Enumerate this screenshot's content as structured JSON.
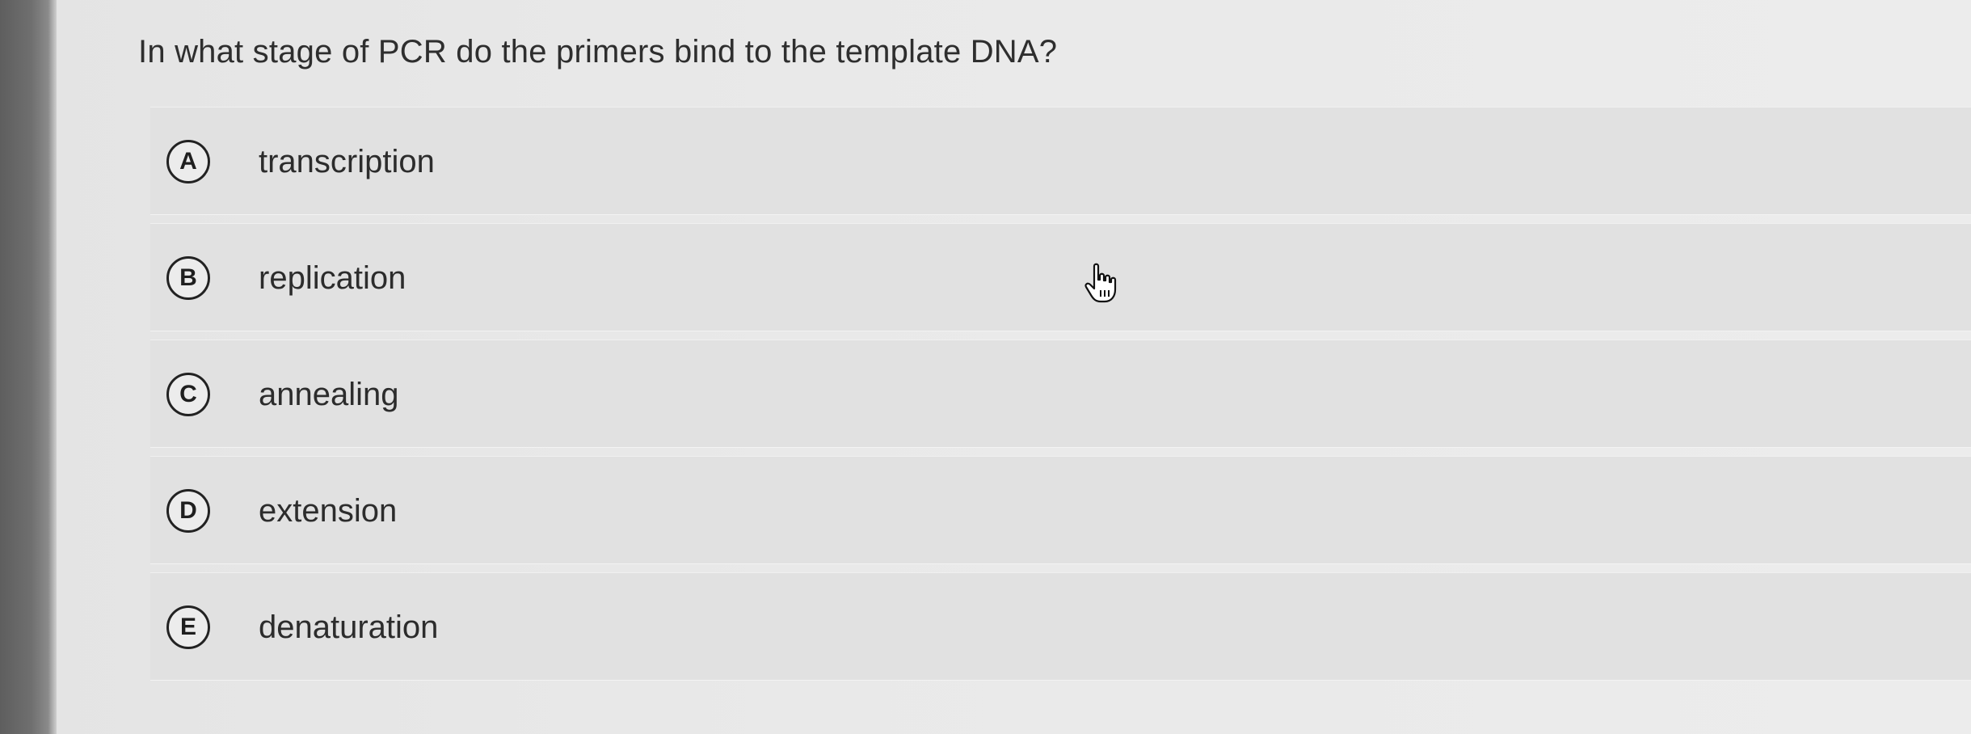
{
  "question": {
    "text": "In what stage of PCR do the primers bind to the template DNA?"
  },
  "options": [
    {
      "letter": "A",
      "label": "transcription"
    },
    {
      "letter": "B",
      "label": "replication"
    },
    {
      "letter": "C",
      "label": "annealing"
    },
    {
      "letter": "D",
      "label": "extension"
    },
    {
      "letter": "E",
      "label": "denaturation"
    }
  ],
  "cursor": {
    "icon": "hand-pointer-icon"
  }
}
